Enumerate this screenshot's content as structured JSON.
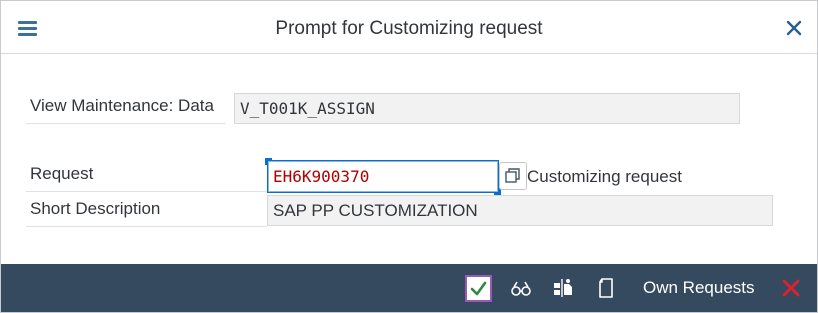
{
  "dialog": {
    "title": "Prompt for Customizing request",
    "menu_icon": "hamburger-menu-icon",
    "close_icon": "close-icon"
  },
  "view_maintenance": {
    "label": "View Maintenance: Data",
    "value": "V_T001K_ASSIGN"
  },
  "request": {
    "label": "Request",
    "value": "EH6K900370",
    "value_help_icon": "copy-value-help-icon",
    "type_text": "Customizing request"
  },
  "short_description": {
    "label": "Short Description",
    "value": "SAP PP CUSTOMIZATION"
  },
  "footer": {
    "continue_icon": "checkmark-icon",
    "display_icon": "glasses-icon",
    "create_icon": "create-request-icon",
    "new_icon": "document-icon",
    "own_requests_label": "Own Requests",
    "cancel_icon": "cancel-x-icon"
  },
  "colors": {
    "accent": "#0a6ed1",
    "footer_bg": "#354a5f",
    "request_text": "#b00000",
    "confirm_green": "#2b8a3e",
    "cancel_red": "#e0202c",
    "focus_purple": "#9b59b6"
  }
}
